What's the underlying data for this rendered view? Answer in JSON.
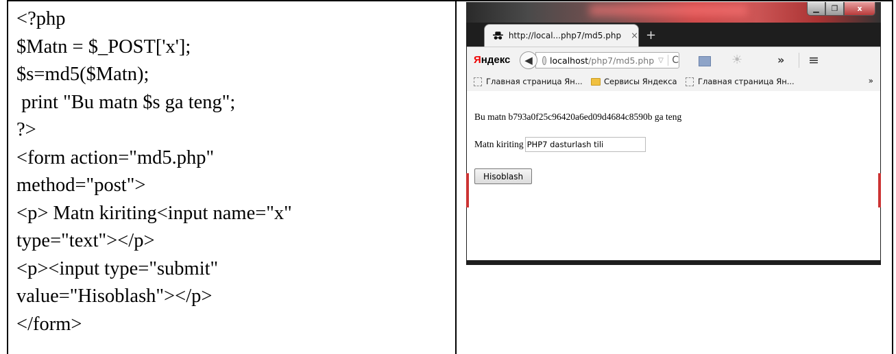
{
  "code": {
    "lines": [
      "<?php",
      "$Matn = $_POST['x'];",
      "$s=md5($Matn);",
      " print \"Bu matn $s ga teng\";",
      "?>",
      "<form action=\"md5.php\"",
      "method=\"post\">",
      "<p> Matn kiriting<input name=\"x\"",
      "type=\"text\"></p>",
      "<p><input type=\"submit\"",
      "value=\"Hisoblash\"></p>",
      "</form>"
    ]
  },
  "browser": {
    "tab": {
      "title": "http://local...php7/md5.php",
      "close": "×",
      "new_tab": "+"
    },
    "window_buttons": {
      "minimize": "▁",
      "maximize": "❐",
      "close": "x"
    },
    "yandex_logo": {
      "first": "Я",
      "rest": "ндекс"
    },
    "url": {
      "host": "localhost",
      "path": "/php7/md5.php",
      "dropdown": "▽",
      "reload": "C"
    },
    "nav_icons": {
      "back": "mail-icon",
      "more": "»",
      "menu": "≡"
    },
    "bookmarks": [
      {
        "label": "Главная страница Ян...",
        "icon": "page-icon"
      },
      {
        "label": "Сервисы Яндекса",
        "icon": "folder-icon"
      },
      {
        "label": "Главная страница Ян...",
        "icon": "page-icon"
      }
    ],
    "bookmarks_overflow": "»",
    "content": {
      "result": "Bu matn b793a0f25c96420a6ed09d4684c8590b ga teng",
      "label": "Matn kiriting",
      "input_value": "PHP7 dasturlash tili",
      "submit_label": "Hisoblash"
    }
  }
}
